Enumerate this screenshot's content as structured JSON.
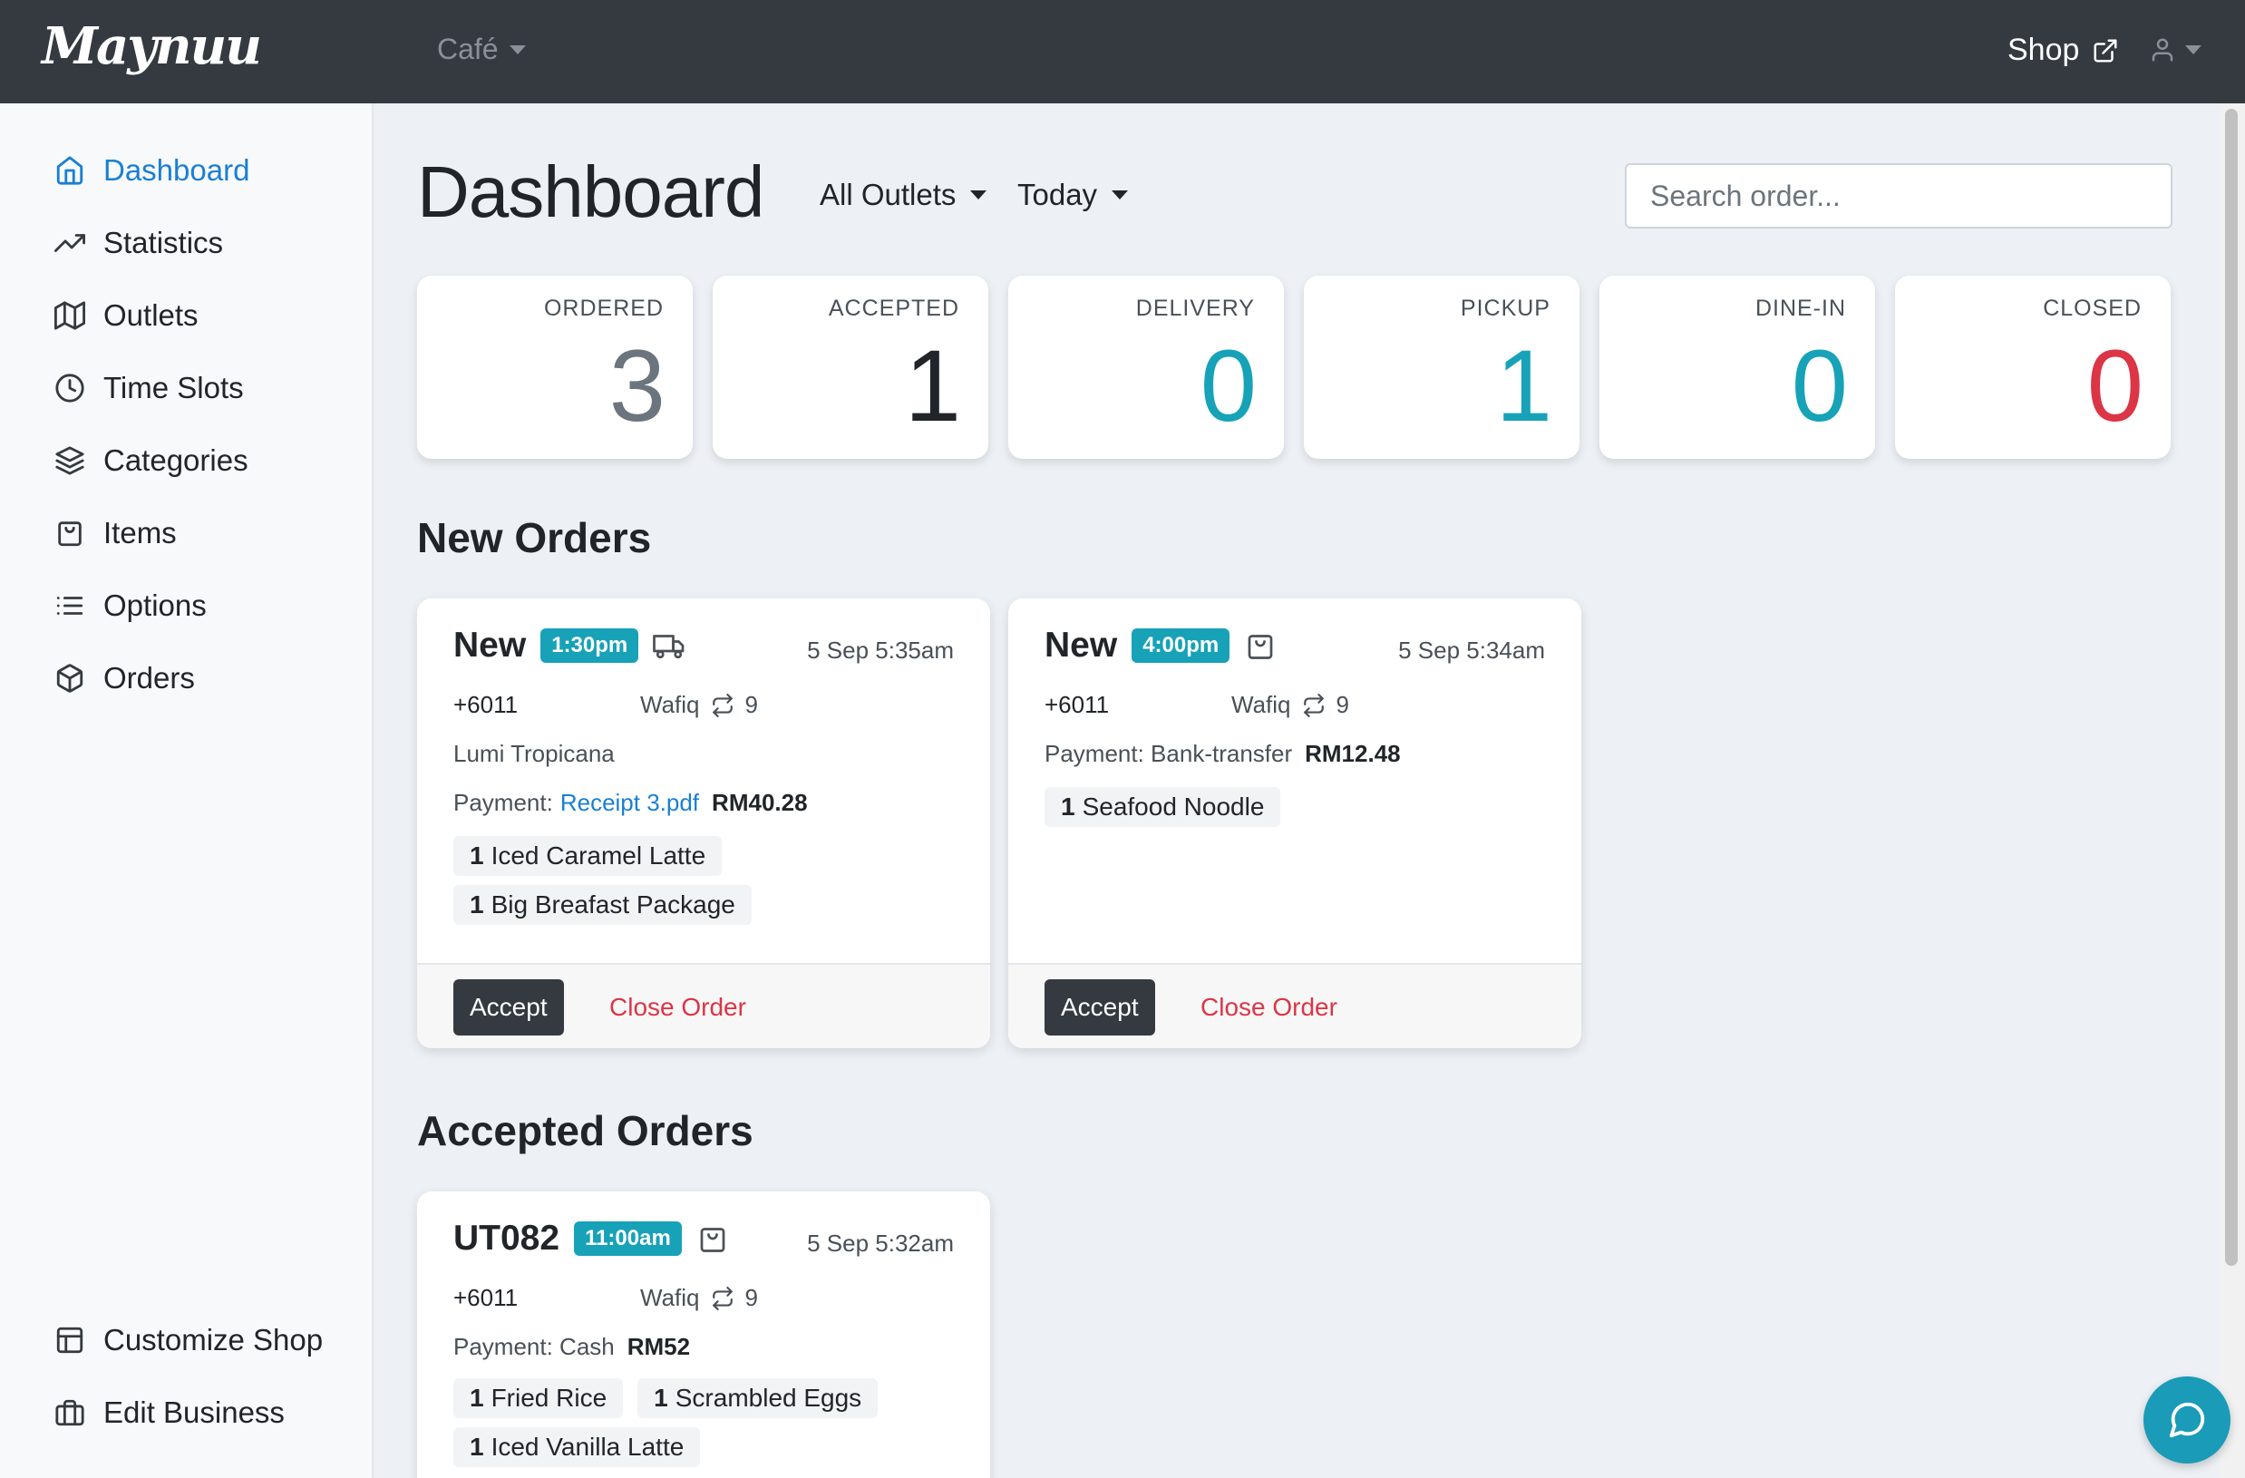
{
  "topbar": {
    "logo": "Maynuu",
    "outlet_select": "Café",
    "shop_label": "Shop"
  },
  "sidebar": {
    "items": [
      {
        "label": "Dashboard",
        "icon": "home-icon",
        "active": true
      },
      {
        "label": "Statistics",
        "icon": "trending-up-icon"
      },
      {
        "label": "Outlets",
        "icon": "map-icon"
      },
      {
        "label": "Time Slots",
        "icon": "clock-icon"
      },
      {
        "label": "Categories",
        "icon": "layers-icon"
      },
      {
        "label": "Items",
        "icon": "shopping-bag-icon"
      },
      {
        "label": "Options",
        "icon": "list-icon"
      },
      {
        "label": "Orders",
        "icon": "package-icon"
      }
    ],
    "bottom_items": [
      {
        "label": "Customize Shop",
        "icon": "layout-icon"
      },
      {
        "label": "Edit Business",
        "icon": "briefcase-icon"
      }
    ]
  },
  "main": {
    "title": "Dashboard",
    "outlet_filter": "All Outlets",
    "date_filter": "Today",
    "search_placeholder": "Search order..."
  },
  "stats": [
    {
      "label": "ORDERED",
      "value": "3",
      "color": "#6c757d"
    },
    {
      "label": "ACCEPTED",
      "value": "1",
      "color": "#212529"
    },
    {
      "label": "DELIVERY",
      "value": "0",
      "color": "#17a2b8"
    },
    {
      "label": "PICKUP",
      "value": "1",
      "color": "#17a2b8"
    },
    {
      "label": "DINE-IN",
      "value": "0",
      "color": "#17a2b8"
    },
    {
      "label": "CLOSED",
      "value": "0",
      "color": "#dc3545"
    }
  ],
  "new_orders": {
    "title": "New Orders",
    "orders": [
      {
        "status": "New",
        "time": "1:30pm",
        "type_icon": "truck-icon",
        "date": "5 Sep 5:35am",
        "phone": "+6011",
        "customer": "Wafiq",
        "repeat_count": "9",
        "address": "Lumi Tropicana",
        "payment_label": "Payment:",
        "payment_link": "Receipt 3.pdf",
        "amount": "RM40.28",
        "items": [
          {
            "qty": "1",
            "name": "Iced Caramel Latte"
          },
          {
            "qty": "1",
            "name": "Big Breafast Package"
          }
        ],
        "accept_label": "Accept",
        "close_label": "Close Order"
      },
      {
        "status": "New",
        "time": "4:00pm",
        "type_icon": "shopping-bag-icon",
        "date": "5 Sep 5:34am",
        "phone": "+6011",
        "customer": "Wafiq",
        "repeat_count": "9",
        "payment_label": "Payment: Bank-transfer",
        "amount": "RM12.48",
        "items": [
          {
            "qty": "1",
            "name": "Seafood Noodle"
          }
        ],
        "accept_label": "Accept",
        "close_label": "Close Order"
      }
    ]
  },
  "accepted_orders": {
    "title": "Accepted Orders",
    "orders": [
      {
        "status": "UT082",
        "time": "11:00am",
        "type_icon": "shopping-bag-icon",
        "date": "5 Sep 5:32am",
        "phone": "+6011",
        "customer": "Wafiq",
        "repeat_count": "9",
        "payment_label": "Payment: Cash",
        "amount": "RM52",
        "items": [
          {
            "qty": "1",
            "name": "Fried Rice"
          },
          {
            "qty": "1",
            "name": "Scrambled Eggs"
          },
          {
            "qty": "1",
            "name": "Iced Vanilla Latte"
          }
        ]
      }
    ]
  },
  "colors": {
    "topbar": "#343a40",
    "accent": "#1a7fd4",
    "info": "#17a2b8",
    "danger": "#dc3545"
  }
}
